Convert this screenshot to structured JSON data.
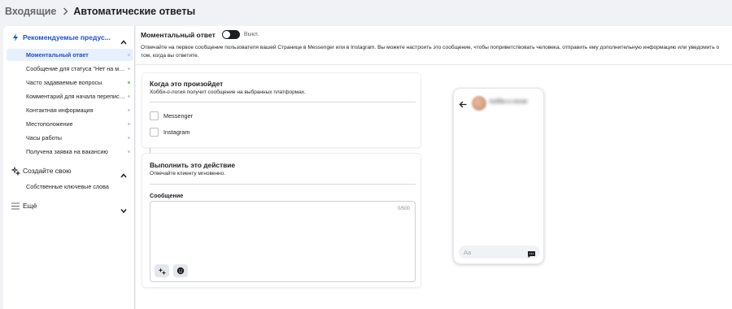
{
  "breadcrumb": {
    "parent": "Входящие",
    "current": "Автоматические ответы"
  },
  "sidebar": {
    "section_recommended": "Рекомендуемые предус...",
    "items": [
      {
        "label": "Моментальный ответ",
        "active": true,
        "dot": "gray"
      },
      {
        "label": "Сообщение для статуса \"Нет на ме...",
        "active": false,
        "dot": "gray"
      },
      {
        "label": "Часто задаваемые вопросы",
        "active": false,
        "dot": "green"
      },
      {
        "label": "Комментарий для начала переписк...",
        "active": false,
        "dot": "gray"
      },
      {
        "label": "Контактная информация",
        "active": false,
        "dot": "gray"
      },
      {
        "label": "Местоположение",
        "active": false,
        "dot": "gray"
      },
      {
        "label": "Часы работы",
        "active": false,
        "dot": "gray"
      },
      {
        "label": "Получена заявка на вакансию",
        "active": false,
        "dot": "gray"
      }
    ],
    "section_create": "Создайте свою",
    "create_item": "Собственные ключевые слова",
    "section_more": "Ещё"
  },
  "main": {
    "title": "Моментальный ответ",
    "toggle_label": "Выкл.",
    "toggle_on": false,
    "description": "Отвечайте на первое сообщение пользователя вашей Странице в Messenger или в Instagram. Вы можете настроить это сообщение, чтобы поприветствовать человека, отправить ему дополнительную информацию или уведомить о том, когда вы ответите."
  },
  "trigger_card": {
    "title": "Когда это произойдет",
    "subtitle": "Хобби-о-логия получит сообщение на выбранных платформах.",
    "options": [
      {
        "label": "Messenger",
        "checked": false
      },
      {
        "label": "Instagram",
        "checked": false
      }
    ]
  },
  "action_card": {
    "title": "Выполнить это действие",
    "subtitle": "Отвечайте клиенту мгновенно.",
    "message_label": "Сообщение",
    "counter": "0/500"
  },
  "preview": {
    "name_blurred": "Хобби-о-логия",
    "input_placeholder": "Aa"
  },
  "colors": {
    "accent": "#1b4fd6",
    "active_bg": "#e7f0fe",
    "green_dot": "#7ec04b"
  }
}
